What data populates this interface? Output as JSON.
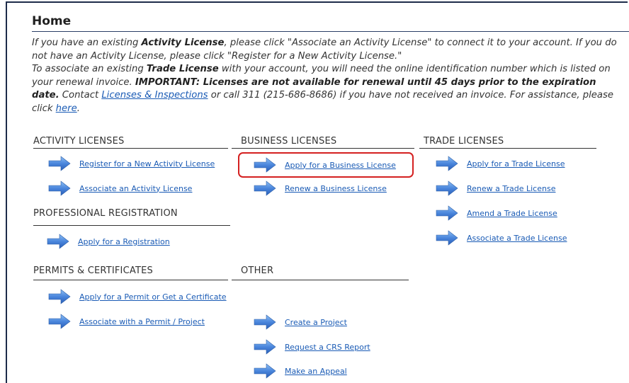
{
  "page": {
    "title": "Home"
  },
  "intro": {
    "p1_a": "If you have an existing ",
    "p1_b": "Activity License",
    "p1_c": ", please click \"Associate an Activity License\" to connect it to your account. If you do not have an Activity License, please click \"Register for a New Activity License.\"",
    "p2_a": "To associate an existing ",
    "p2_b": "Trade License",
    "p2_c": " with your account, you will need the online identification number which is listed on your renewal invoice. ",
    "p2_d": "IMPORTANT: Licenses are not available for renewal until 45 days prior to the expiration date.",
    "p2_e": " Contact ",
    "p2_link1": "Licenses & Inspections",
    "p2_f": " or call 311 (215-686-8686) if you have not received an invoice. For assistance, please click ",
    "p2_link2": "here",
    "p2_g": "."
  },
  "sections": {
    "activity": {
      "heading": "ACTIVITY LICENSES",
      "links": [
        "Register for a New Activity License",
        "Associate an Activity License"
      ]
    },
    "business": {
      "heading": "BUSINESS LICENSES",
      "links": [
        "Apply for a Business License",
        "Renew a Business License"
      ]
    },
    "trade": {
      "heading": "TRADE LICENSES",
      "links": [
        "Apply for a Trade License",
        "Renew a Trade License",
        "Amend a Trade License",
        "Associate a Trade License"
      ]
    },
    "professional": {
      "heading": "PROFESSIONAL REGISTRATION",
      "links": [
        "Apply for a Registration"
      ]
    },
    "permits": {
      "heading": "PERMITS & CERTIFICATES",
      "links": [
        "Apply for a Permit or Get a Certificate",
        "Associate with a Permit / Project"
      ]
    },
    "other": {
      "heading": "OTHER",
      "links": [
        "Create a Project",
        "Request a CRS Report",
        "Make an Appeal"
      ]
    }
  },
  "icons": {
    "link_arrow": "right-arrow-icon"
  },
  "colors": {
    "link": "#1a5bb5",
    "arrow": "#3a78d6",
    "highlight": "#d42020",
    "frame": "#1d2b4a"
  }
}
